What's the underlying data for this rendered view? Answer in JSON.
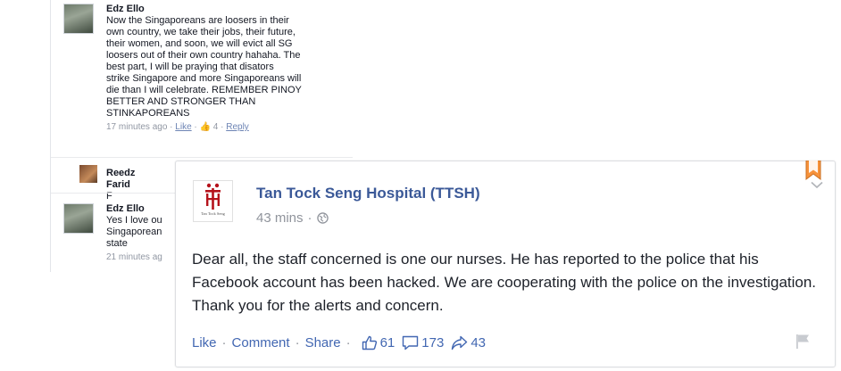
{
  "comments": [
    {
      "name": "Edz Ello",
      "text": "Now the Singaporeans are loosers in their\nown country, we take their jobs, their future,\ntheir women, and soon, we will evict all SG\nloosers out of their own country hahaha. The\nbest part, I will be praying that disators\nstrike Singapore and more Singaporeans will\ndie than I will celebrate. REMEMBER PINOY\nBETTER AND STRONGER THAN\nSTINKAPOREANS",
      "time": "17 minutes ago",
      "like_label": "Like",
      "like_count": "4",
      "reply_label": "Reply"
    },
    {
      "name": "Reedz Farid",
      "text": "F"
    },
    {
      "name": "Edz Ello",
      "text": "Yes I love ou\nSingaporean\nstate",
      "time": "21 minutes ag"
    }
  ],
  "post": {
    "page_name": "Tan Tock Seng Hospital (TTSH)",
    "time": "43 mins",
    "text": "Dear all, the staff concerned is one our nurses. He has reported to the police that his Facebook account has been hacked. We are cooperating with the police on the investigation. Thank you for the alerts and concern.",
    "logo_caption": "Tan Tock Seng",
    "actions": {
      "like": "Like",
      "comment": "Comment",
      "share": "Share"
    },
    "stats": {
      "likes": "61",
      "comments": "173",
      "shares": "43"
    }
  },
  "colors": {
    "link_blue": "#3b5998",
    "action_blue": "#4267b2",
    "meta_gray": "#90949c",
    "bookmark_orange": "#f7923a",
    "logo_red": "#b5121b"
  },
  "icons": [
    "globe-icon",
    "like-thumb-icon",
    "comment-bubble-icon",
    "share-arrow-icon",
    "bookmark-icon",
    "chevron-down-icon",
    "flag-icon"
  ]
}
